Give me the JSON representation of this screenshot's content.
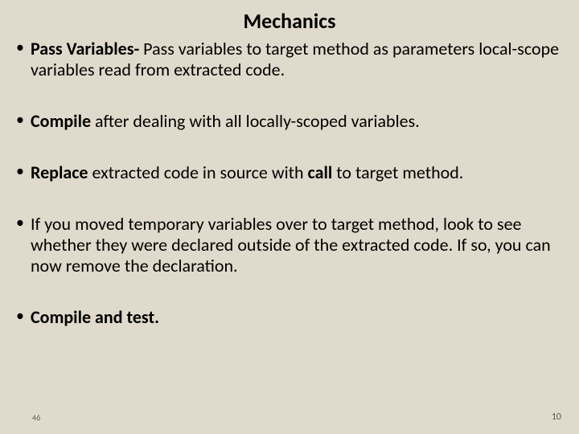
{
  "title": "Mechanics",
  "bullets": {
    "b1": {
      "strong": "Pass Variables-",
      "rest": "  Pass variables to target method as parameters local-scope variables read from extracted code."
    },
    "b2": {
      "strong": "Compile",
      "rest": " after dealing with all locally-scoped variables."
    },
    "b3": {
      "strong1": "Replace",
      "mid": " extracted code in source with ",
      "strong2": "call",
      "rest": " to target method."
    },
    "b4": {
      "text": "If you moved temporary variables over to target method, look to see whether they were declared outside of the extracted code. If so, you can now remove the declaration."
    },
    "b5": {
      "strong": "Compile and test."
    }
  },
  "footer": {
    "left": "46",
    "right": "10"
  }
}
